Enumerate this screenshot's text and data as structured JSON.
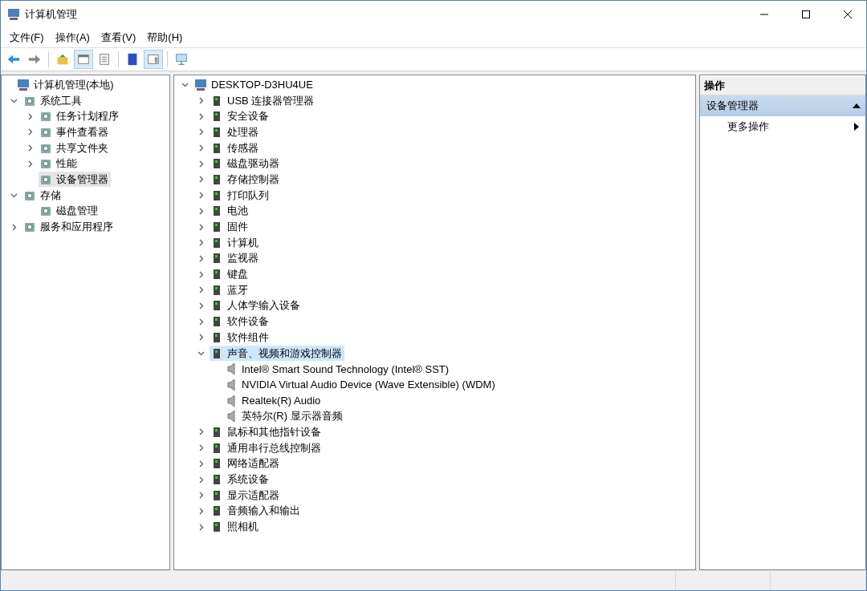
{
  "window": {
    "title": "计算机管理"
  },
  "menu": [
    "文件(F)",
    "操作(A)",
    "查看(V)",
    "帮助(H)"
  ],
  "toolbar": [
    {
      "pressed": false
    },
    {
      "pressed": false
    },
    {
      "pressed": false
    },
    {
      "pressed": true
    },
    {
      "pressed": false
    },
    {
      "pressed": false
    },
    {
      "pressed": true
    },
    {
      "pressed": false
    }
  ],
  "nav_tree": [
    {
      "label": "计算机管理(本地)",
      "selected": false,
      "children": [
        {
          "label": "系统工具",
          "expandable": true,
          "expanded": true,
          "selected": false,
          "children": [
            {
              "label": "任务计划程序",
              "expandable": true,
              "expanded": false,
              "selected": false
            },
            {
              "label": "事件查看器",
              "expandable": true,
              "expanded": false,
              "selected": false
            },
            {
              "label": "共享文件夹",
              "expandable": true,
              "expanded": false,
              "selected": false
            },
            {
              "label": "性能",
              "expandable": true,
              "expanded": false,
              "selected": false
            },
            {
              "label": "设备管理器",
              "expandable": false,
              "expanded": false,
              "selected": true
            }
          ]
        },
        {
          "label": "存储",
          "expandable": true,
          "expanded": true,
          "selected": false,
          "children": [
            {
              "label": "磁盘管理",
              "expandable": false,
              "expanded": false,
              "selected": false
            }
          ]
        },
        {
          "label": "服务和应用程序",
          "expandable": true,
          "expanded": false,
          "selected": false
        }
      ]
    }
  ],
  "device_tree": [
    {
      "label": "DESKTOP-D3HU4UE",
      "expandable": true,
      "expanded": true,
      "selected": false,
      "children": [
        {
          "label": "USB 连接器管理器",
          "expandable": true,
          "expanded": false,
          "selected": false
        },
        {
          "label": "安全设备",
          "expandable": true,
          "expanded": false,
          "selected": false
        },
        {
          "label": "处理器",
          "expandable": true,
          "expanded": false,
          "selected": false
        },
        {
          "label": "传感器",
          "expandable": true,
          "expanded": false,
          "selected": false
        },
        {
          "label": "磁盘驱动器",
          "expandable": true,
          "expanded": false,
          "selected": false
        },
        {
          "label": "存储控制器",
          "expandable": true,
          "expanded": false,
          "selected": false
        },
        {
          "label": "打印队列",
          "expandable": true,
          "expanded": false,
          "selected": false
        },
        {
          "label": "电池",
          "expandable": true,
          "expanded": false,
          "selected": false
        },
        {
          "label": "固件",
          "expandable": true,
          "expanded": false,
          "selected": false
        },
        {
          "label": "计算机",
          "expandable": true,
          "expanded": false,
          "selected": false
        },
        {
          "label": "监视器",
          "expandable": true,
          "expanded": false,
          "selected": false
        },
        {
          "label": "键盘",
          "expandable": true,
          "expanded": false,
          "selected": false
        },
        {
          "label": "蓝牙",
          "expandable": true,
          "expanded": false,
          "selected": false
        },
        {
          "label": "人体学输入设备",
          "expandable": true,
          "expanded": false,
          "selected": false
        },
        {
          "label": "软件设备",
          "expandable": true,
          "expanded": false,
          "selected": false
        },
        {
          "label": "软件组件",
          "expandable": true,
          "expanded": false,
          "selected": false
        },
        {
          "label": "声音、视频和游戏控制器",
          "expandable": true,
          "expanded": true,
          "selected": true,
          "children": [
            {
              "label": "Intel® Smart Sound Technology (Intel® SST)",
              "expandable": false,
              "expanded": false,
              "selected": false
            },
            {
              "label": "NVIDIA Virtual Audio Device (Wave Extensible) (WDM)",
              "expandable": false,
              "expanded": false,
              "selected": false
            },
            {
              "label": "Realtek(R) Audio",
              "expandable": false,
              "expanded": false,
              "selected": false
            },
            {
              "label": "英特尔(R) 显示器音频",
              "expandable": false,
              "expanded": false,
              "selected": false
            }
          ]
        },
        {
          "label": "鼠标和其他指针设备",
          "expandable": true,
          "expanded": false,
          "selected": false
        },
        {
          "label": "通用串行总线控制器",
          "expandable": true,
          "expanded": false,
          "selected": false
        },
        {
          "label": "网络适配器",
          "expandable": true,
          "expanded": false,
          "selected": false
        },
        {
          "label": "系统设备",
          "expandable": true,
          "expanded": false,
          "selected": false
        },
        {
          "label": "显示适配器",
          "expandable": true,
          "expanded": false,
          "selected": false
        },
        {
          "label": "音频输入和输出",
          "expandable": true,
          "expanded": false,
          "selected": false
        },
        {
          "label": "照相机",
          "expandable": true,
          "expanded": false,
          "selected": false
        }
      ]
    }
  ],
  "actions": {
    "title": "操作",
    "section": {
      "label": "设备管理器",
      "expanded": true
    },
    "items": [
      "更多操作"
    ]
  }
}
